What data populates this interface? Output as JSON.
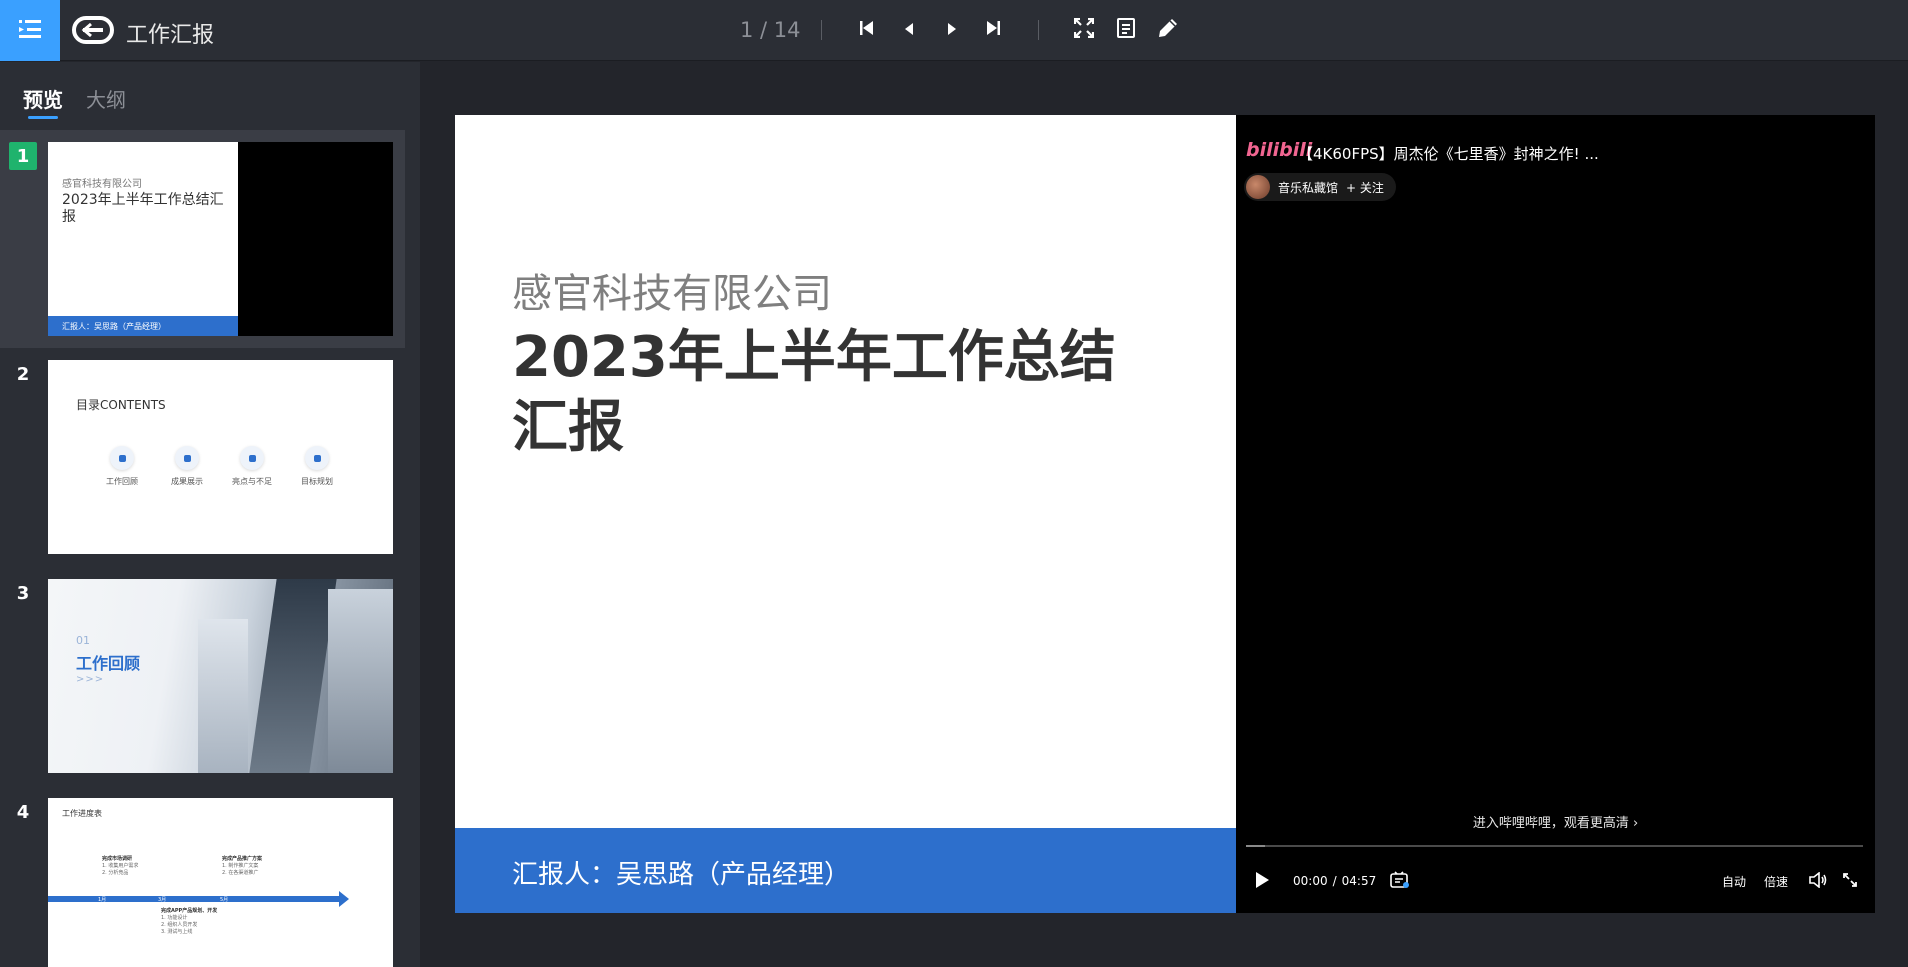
{
  "header": {
    "app_title": "工作汇报",
    "page_indicator": "1 / 14",
    "icons": [
      "menu-icon",
      "logo-icon",
      "first-page-icon",
      "prev-page-icon",
      "next-page-icon",
      "last-page-icon",
      "fullscreen-icon",
      "notes-icon",
      "pen-icon"
    ],
    "accent_color": "#3aa0ff"
  },
  "sidebar": {
    "tabs": [
      {
        "label": "预览",
        "active": true
      },
      {
        "label": "大纲",
        "active": false
      }
    ],
    "slides": [
      {
        "number": "1",
        "selected": true,
        "company": "感官科技有限公司",
        "title": "2023年上半年工作总结汇报",
        "footer": "汇报人：吴思路（产品经理）"
      },
      {
        "number": "2",
        "selected": false,
        "title": "目录CONTENTS",
        "items": [
          "工作回顾",
          "成果展示",
          "亮点与不足",
          "目标规划"
        ]
      },
      {
        "number": "3",
        "selected": false,
        "section_num": "01",
        "title": "工作回顾",
        "arrows": ">>>"
      },
      {
        "number": "4",
        "selected": false,
        "title": "工作进度表",
        "months": [
          "1月",
          "3月",
          "5月"
        ],
        "blocks": [
          {
            "title": "完成市场调研",
            "lines": [
              "1. 收集用户需求",
              "2. 分析竞品"
            ]
          },
          {
            "title": "完成产品推广方案",
            "lines": [
              "1. 制作推广文案",
              "2. 在各渠道推广"
            ]
          },
          {
            "title": "完成APP产品规划、开发",
            "lines": [
              "1. 功能设计",
              "2. 组织人员开发",
              "3. 测试与上线"
            ]
          }
        ]
      }
    ]
  },
  "slide": {
    "company": "感官科技有限公司",
    "title": "2023年上半年工作总结汇报",
    "reporter": "汇报人：吴思路（产品经理）",
    "brand_color": "#2d6fcc"
  },
  "video": {
    "platform_logo": "bilibili",
    "title": "【4K60FPS】周杰伦《七里香》封神之作! ...",
    "author": "音乐私藏馆",
    "follow": "+ 关注",
    "enter_link": "进入哔哩哔哩，观看更高清 ›",
    "current_time": "00:00",
    "time_sep": "/",
    "duration": "04:57",
    "quality": "自动",
    "speed": "倍速",
    "progress": 0.03,
    "icons": [
      "play-icon",
      "danmaku-icon",
      "volume-icon",
      "fullscreen-icon"
    ]
  }
}
